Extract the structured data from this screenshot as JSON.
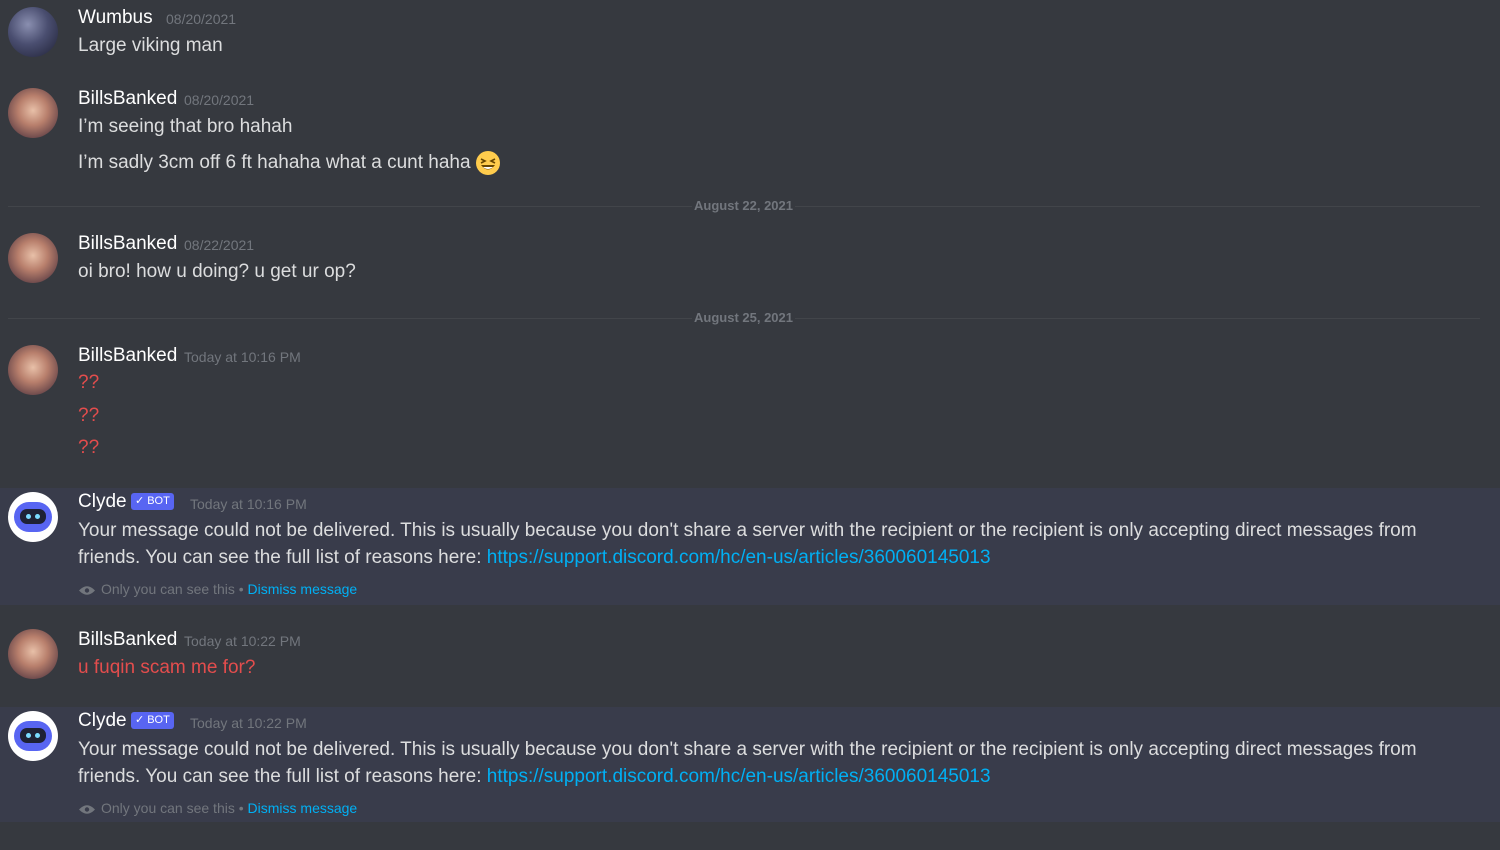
{
  "messages": [
    {
      "username": "Wumbus",
      "timestamp": "08/20/2021",
      "lines": [
        "Large viking man"
      ]
    },
    {
      "username": "BillsBanked",
      "timestamp": "08/20/2021",
      "lines": [
        "I’m seeing that bro hahah",
        "I’m sadly 3cm off 6 ft hahaha what a cunt haha"
      ],
      "emoji": "laughing-emoji"
    },
    {
      "username": "BillsBanked",
      "timestamp": "08/22/2021",
      "lines": [
        "oi bro! how u doing? u get ur op?"
      ]
    },
    {
      "username": "BillsBanked",
      "timestamp": "Today at 10:16 PM",
      "lines": [
        "??",
        "??",
        "??"
      ]
    },
    {
      "username": "Clyde",
      "badge": "BOT",
      "timestamp": "Today at 10:16 PM",
      "body": "Your message could not be delivered. This is usually because you don't share a server with the recipient or the recipient is only accepting direct messages from friends. You can see the full list of reasons here: ",
      "link": "https://support.discord.com/hc/en-us/articles/360060145013",
      "ephemeral": "Only you can see this •",
      "dismiss": "Dismiss message"
    },
    {
      "username": "BillsBanked",
      "timestamp": "Today at 10:22 PM",
      "lines": [
        "u fuqin scam me for?"
      ]
    },
    {
      "username": "Clyde",
      "badge": "BOT",
      "timestamp": "Today at 10:22 PM",
      "body": "Your message could not be delivered. This is usually because you don't share a server with the recipient or the recipient is only accepting direct messages from friends. You can see the full list of reasons here: ",
      "link": "https://support.discord.com/hc/en-us/articles/360060145013",
      "ephemeral": "Only you can see this •",
      "dismiss": "Dismiss message"
    }
  ],
  "dividers": [
    "August 22, 2021",
    "August 25, 2021"
  ],
  "colors": {
    "background": "#36393f",
    "username": "#ffffff",
    "link": "#00b0f4",
    "red_text": "#e34d4d",
    "bot_badge": "#5865f2"
  }
}
